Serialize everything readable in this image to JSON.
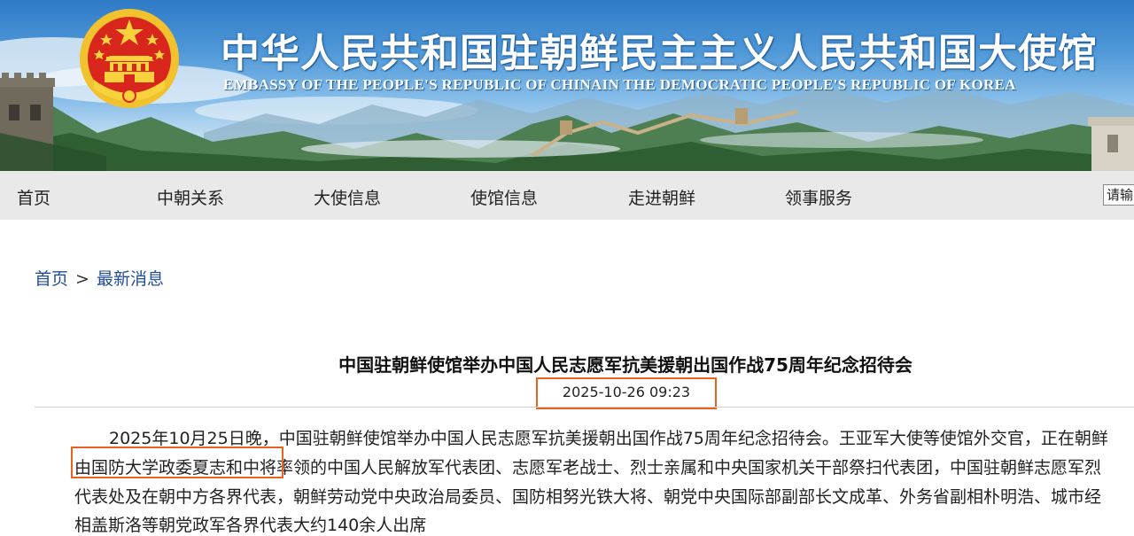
{
  "site": {
    "title_cn": "中华人民共和国驻朝鲜民主主义人民共和国大使馆",
    "title_en": "EMBASSY OF THE PEOPLE'S REPUBLIC OF CHINAIN THE DEMOCRATIC PEOPLE'S REPUBLIC OF KOREA",
    "emblem": "national-emblem",
    "colors": {
      "banner_sky": "#4f98d8",
      "emblem_red": "#d8261c",
      "emblem_gold": "#f2c12e",
      "nav_bg": "#e9e9e9",
      "link": "#1f4e9a",
      "highlight_box": "#e8641c"
    }
  },
  "nav": {
    "items": [
      {
        "label": "首页"
      },
      {
        "label": "中朝关系"
      },
      {
        "label": "大使信息"
      },
      {
        "label": "使馆信息"
      },
      {
        "label": "走进朝鲜"
      },
      {
        "label": "领事服务"
      }
    ],
    "search_placeholder": "请输"
  },
  "breadcrumb": {
    "home": "首页",
    "separator": ">",
    "current": "最新消息"
  },
  "article": {
    "title": "中国驻朝鲜使馆举办中国人民志愿军抗美援朝出国作战75周年纪念招待会",
    "date": "2025-10-26 09:23",
    "lines": [
      "2025年10月25日晚，中国驻朝鲜使馆举办中国人民志愿军抗美援朝出国作战75周年纪念招待会。王亚军大使等使馆外交官，正在朝鲜",
      "由国防大学政委夏志和中将率领的中国人民解放军代表团、志愿军老战士、烈士亲属和中央国家机关干部祭扫代表团，中国驻朝鲜志愿军烈",
      "代表处及在朝中方各界代表，朝鲜劳动党中央政治局委员、国防相努光铁大将、朝党中央国际部副部长文成革、外务省副相朴明浩、城市经",
      "相盖斯洛等朝党政军各界代表大约140余人出席"
    ]
  }
}
